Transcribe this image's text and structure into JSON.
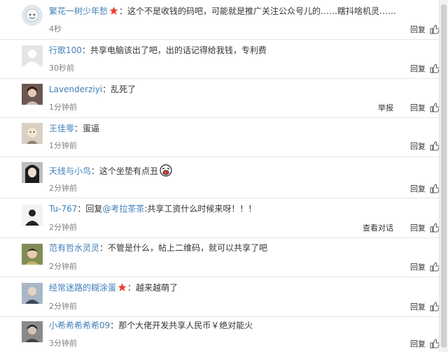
{
  "colors": {
    "username": "#eb7350",
    "link": "#3f7fb8",
    "meta": "#808080"
  },
  "comments": [
    {
      "user": "繁花一树少年愁",
      "badge": "star-icon",
      "text": "：这个不是收钱的码吧，可能就是推广关注公众号儿的……瞎抖啥机灵……",
      "time": "4秒",
      "actions": [
        "回复"
      ]
    },
    {
      "user": "行歌100",
      "text": "：共享电脑该出了吧，出的话记得给我钱，专利费",
      "time": "30秒前",
      "actions": [
        "回复"
      ]
    },
    {
      "user": "Lavenderziyi",
      "text": "：乱死了",
      "time": "1分钟前",
      "actions": [
        "举报",
        "回复"
      ]
    },
    {
      "user": "王佳零",
      "text": "：蛋逼",
      "time": "1分钟前",
      "actions": [
        "回复"
      ]
    },
    {
      "user": "天线与小鸟",
      "text": "：这个坐垫有点丑",
      "emoji": "laughing-face-emoji",
      "time": "2分钟前",
      "actions": [
        "回复"
      ]
    },
    {
      "user": "Tu-767",
      "text_prefix": "：回复",
      "mention": "@考拉茶茶",
      "text": ":共享工资什么时候来呀！！！",
      "time": "2分钟前",
      "actions": [
        "查看对话",
        "回复"
      ]
    },
    {
      "user": "范有哲水灵灵",
      "text": "：不管是什么，帖上二维码，就可以共享了吧",
      "time": "2分钟前",
      "actions": [
        "回复"
      ]
    },
    {
      "user": "经常迷路的糊涂蛋",
      "badge": "star-icon",
      "text": "：越来越萌了",
      "time": "2分钟前",
      "actions": [
        "回复"
      ]
    },
    {
      "user": "小希希希希希09",
      "text": "：那个大佬开发共享人民币￥绝对能火",
      "time": "3分钟前",
      "actions": [
        "回复"
      ]
    }
  ]
}
